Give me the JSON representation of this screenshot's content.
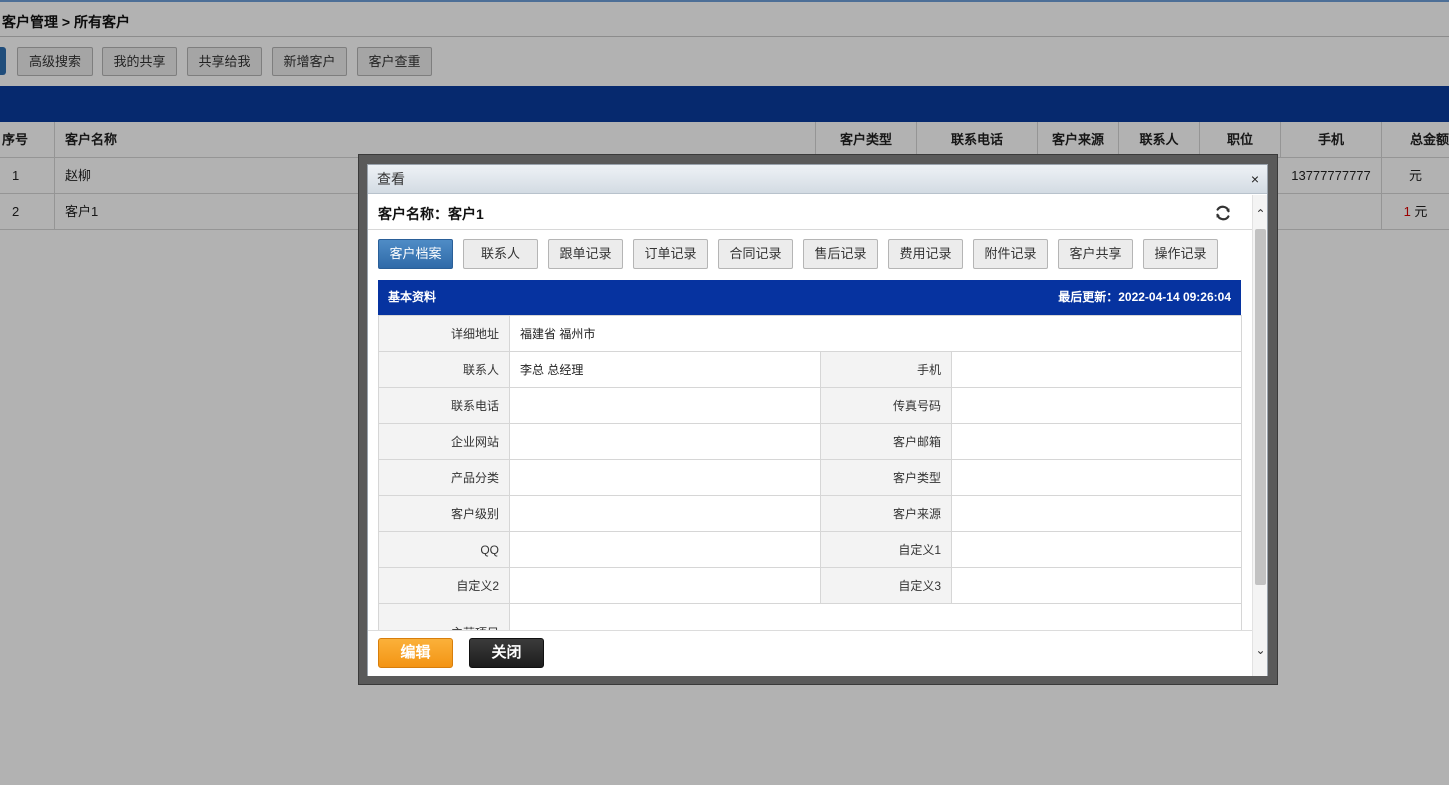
{
  "breadcrumb": "客户管理 > 所有客户",
  "toolbar": {
    "buttons": [
      "高级搜索",
      "我的共享",
      "共享给我",
      "新增客户",
      "客户查重"
    ]
  },
  "grid": {
    "headers": {
      "seq": "序号",
      "name": "客户名称",
      "type": "客户类型",
      "phone": "联系电话",
      "source": "客户来源",
      "contact": "联系人",
      "position": "职位",
      "mobile": "手机",
      "total": "总金额"
    },
    "rows": [
      {
        "seq": "1",
        "name": "赵柳",
        "mobile": "13777777777",
        "total_num": "",
        "total_unit": "元"
      },
      {
        "seq": "2",
        "name": "客户1",
        "mobile": "",
        "total_num": "1",
        "total_unit": " 元"
      }
    ]
  },
  "modal": {
    "title": "查看",
    "close": "×",
    "customer_label": "客户名称：客户1",
    "tabs": [
      "客户档案",
      "联系人",
      "跟单记录",
      "订单记录",
      "合同记录",
      "售后记录",
      "费用记录",
      "附件记录",
      "客户共享",
      "操作记录"
    ],
    "section": {
      "title": "基本资料",
      "updated": "最后更新：2022-04-14 09:26:04"
    },
    "fields": {
      "address_label": "详细地址",
      "address": "福建省  福州市",
      "contact_label": "联系人",
      "contact": "李总  总经理",
      "mobile_label": "手机",
      "mobile": "",
      "phone_label": "联系电话",
      "phone": "",
      "fax_label": "传真号码",
      "fax": "",
      "website_label": "企业网站",
      "website": "",
      "email_label": "客户邮箱",
      "email": "",
      "product_label": "产品分类",
      "product": "",
      "ctype_label": "客户类型",
      "ctype": "",
      "level_label": "客户级别",
      "level": "",
      "source_label": "客户来源",
      "source": "",
      "qq_label": "QQ",
      "qq": "",
      "custom1_label": "自定义1",
      "custom1": "",
      "custom2_label": "自定义2",
      "custom2": "",
      "custom3_label": "自定义3",
      "custom3": "",
      "main_label": "主营项目",
      "main": ""
    },
    "footer": {
      "edit": "编辑",
      "close": "关闭"
    }
  },
  "colors": {
    "header_blue": "#0633a0",
    "band_blue": "#0a3c9e",
    "edit_orange": "#f39414",
    "active_tab": "#2f6aa8"
  }
}
